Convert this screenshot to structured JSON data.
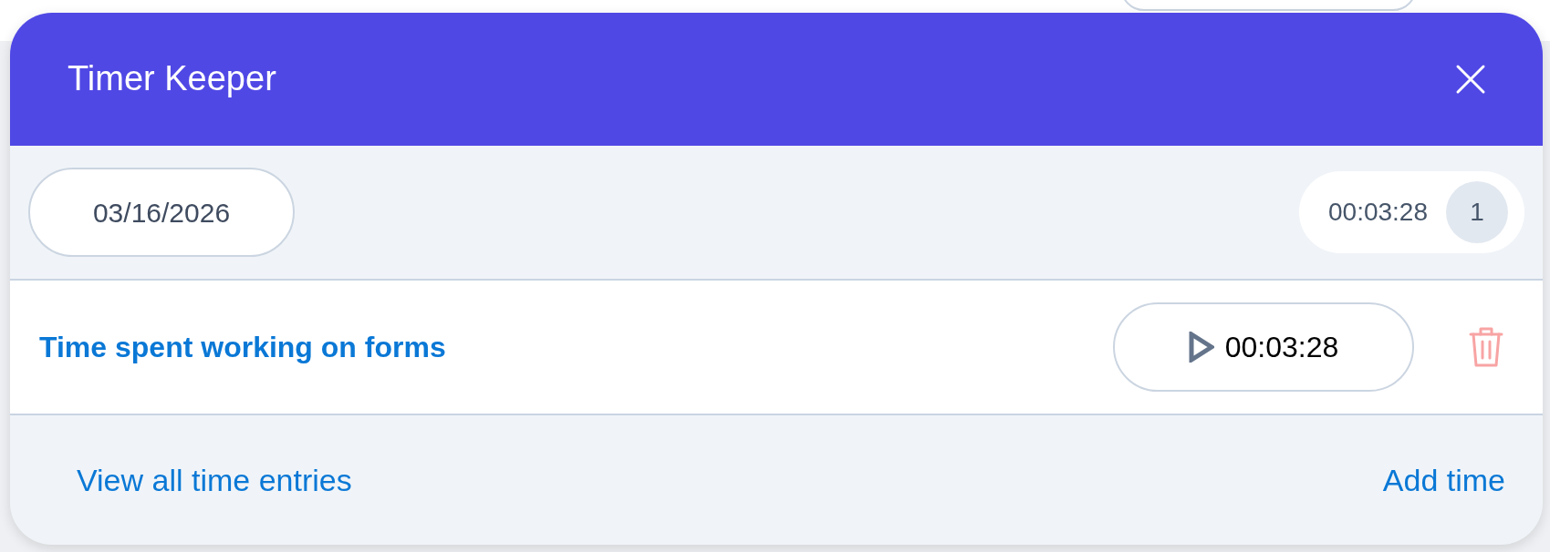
{
  "dialog": {
    "title": "Timer Keeper"
  },
  "date": "03/16/2026",
  "total": {
    "time": "00:03:28",
    "count": "1"
  },
  "entries": [
    {
      "title": "Time spent working on forms",
      "time": "00:03:28",
      "running": false
    }
  ],
  "footer": {
    "links": [
      "View all time entries",
      "Add time"
    ]
  }
}
